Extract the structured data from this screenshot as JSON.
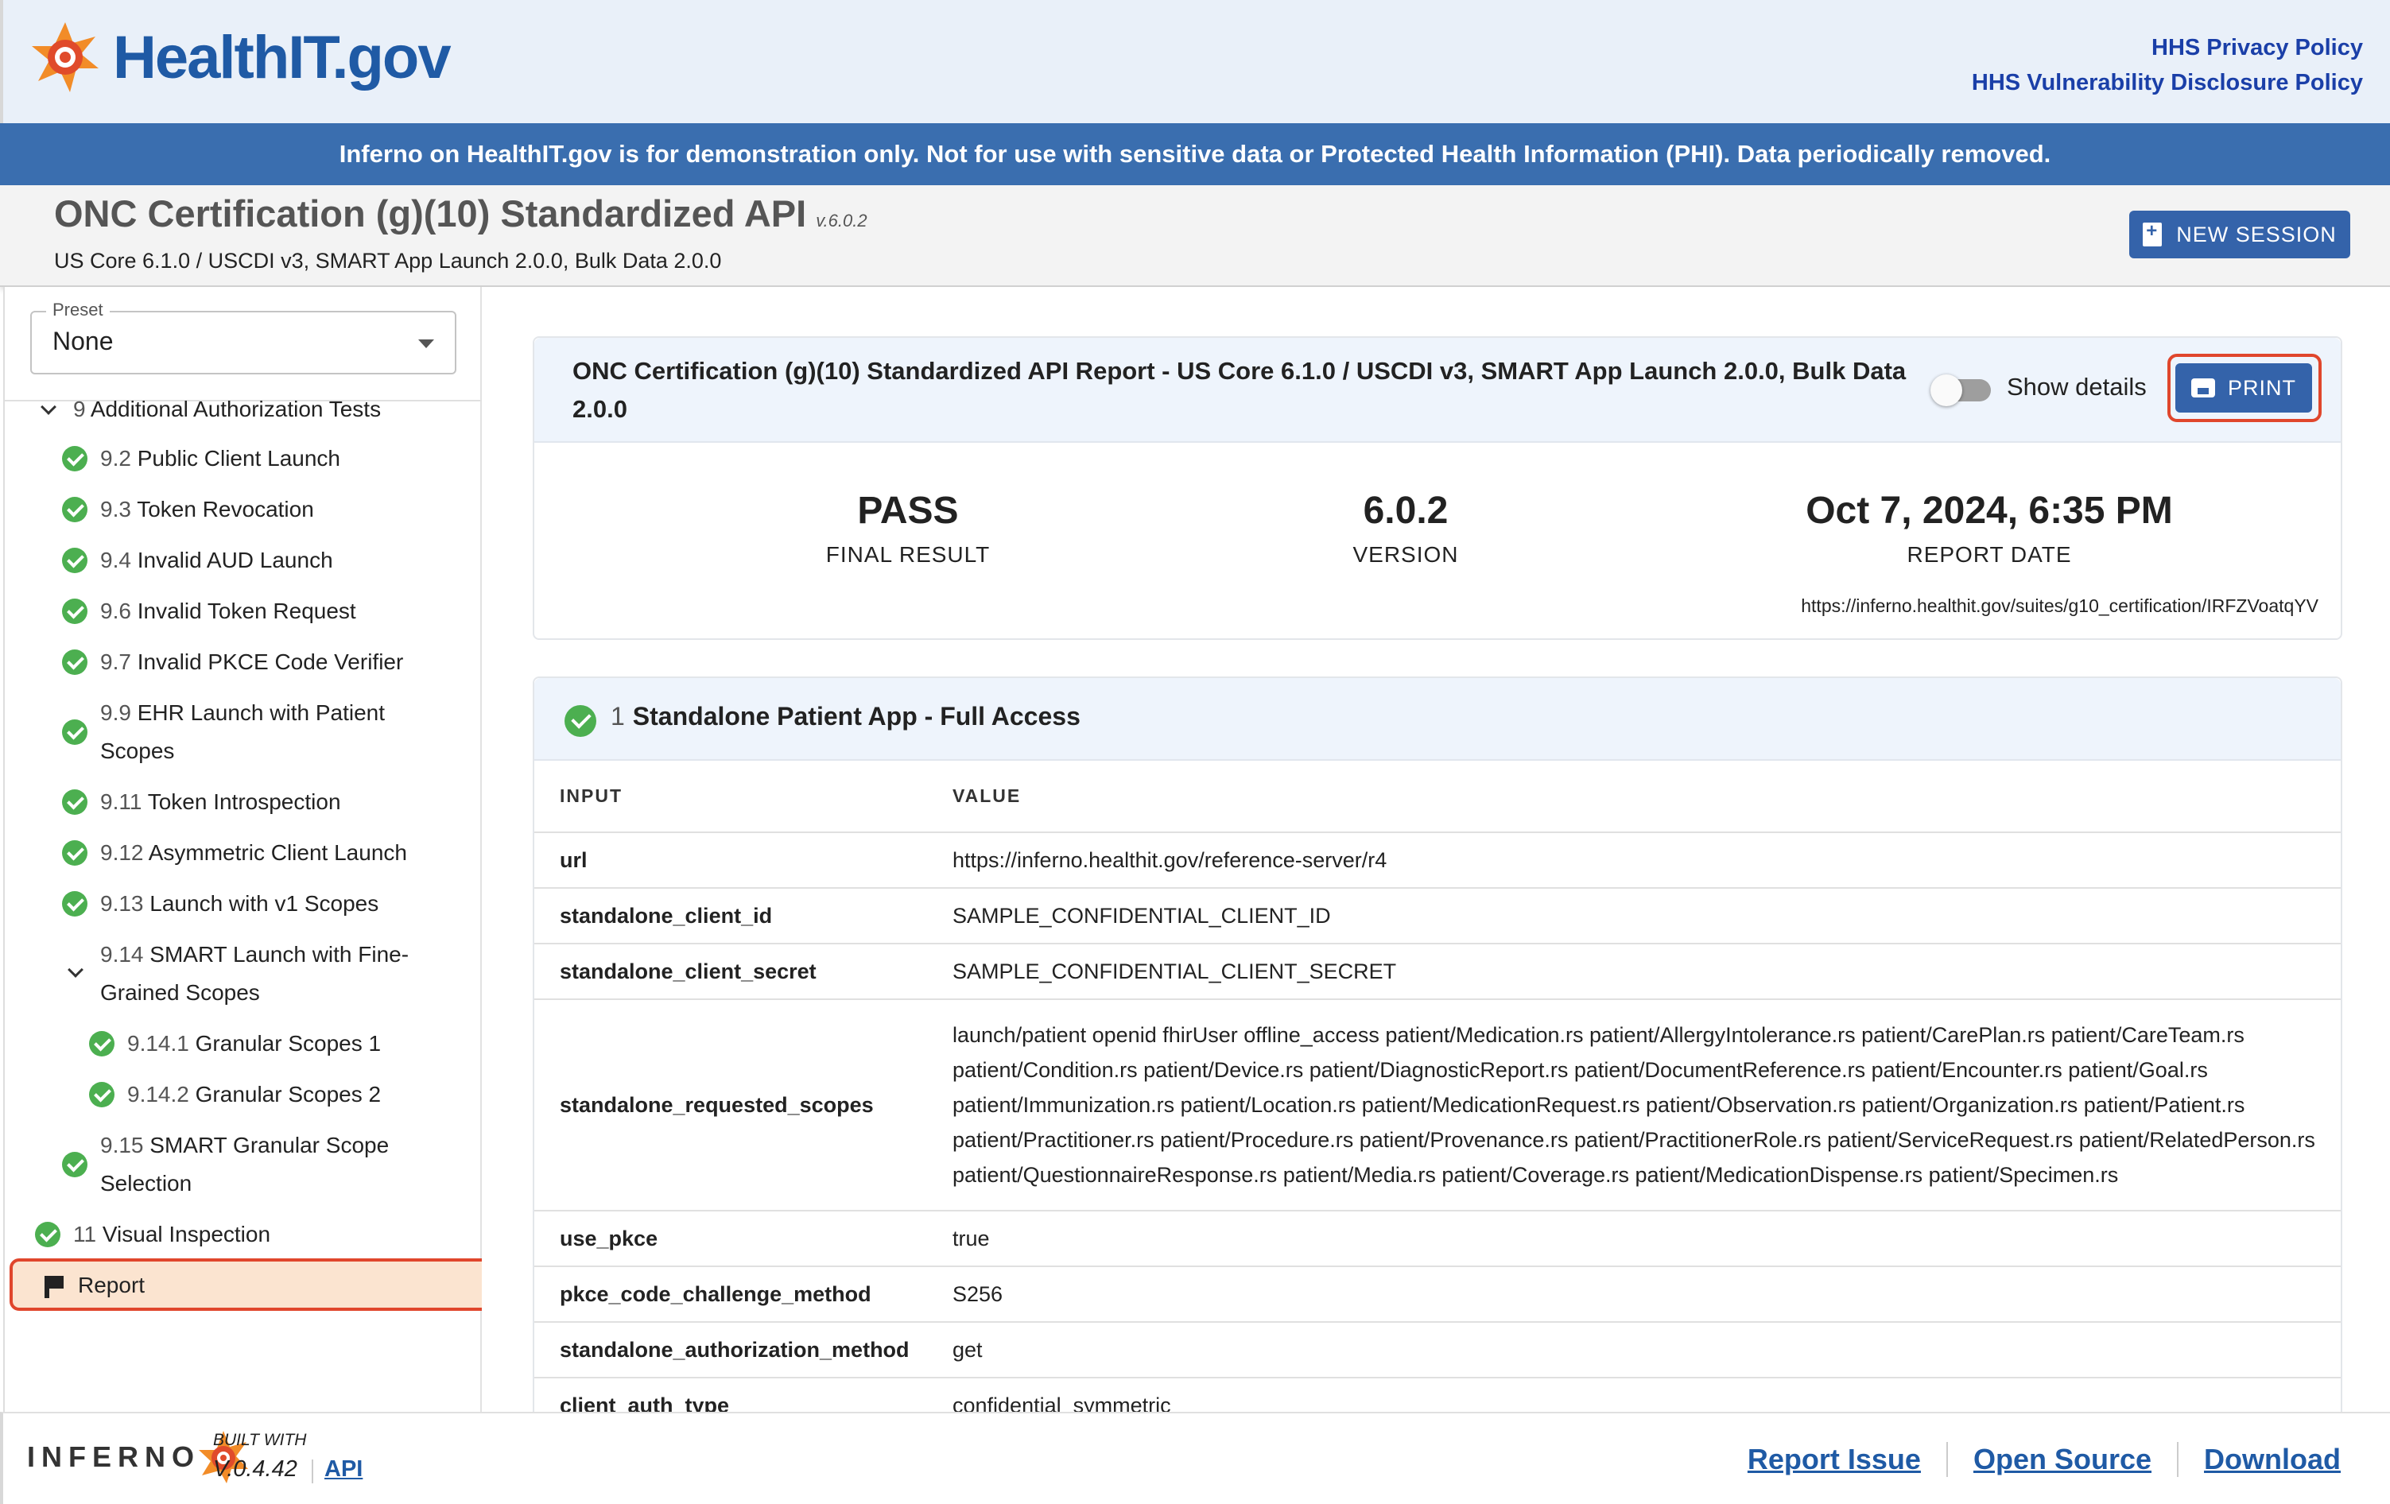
{
  "header": {
    "logo_text": "HealthIT.gov",
    "links": [
      "HHS Privacy Policy",
      "HHS Vulnerability Disclosure Policy"
    ]
  },
  "banner": "Inferno on HealthIT.gov is for demonstration only. Not for use with sensitive data or Protected Health Information (PHI). Data periodically removed.",
  "suite": {
    "title": "ONC Certification (g)(10) Standardized API",
    "version": "v.6.0.2",
    "subtitle": "US Core 6.1.0 / USCDI v3, SMART App Launch 2.0.0, Bulk Data 2.0.0",
    "new_session": "NEW SESSION"
  },
  "sidebar": {
    "preset_label": "Preset",
    "preset_value": "None",
    "items": [
      {
        "num": "9",
        "label": "Additional Authorization Tests"
      },
      {
        "num": "9.2",
        "label": "Public Client Launch"
      },
      {
        "num": "9.3",
        "label": "Token Revocation"
      },
      {
        "num": "9.4",
        "label": "Invalid AUD Launch"
      },
      {
        "num": "9.6",
        "label": "Invalid Token Request"
      },
      {
        "num": "9.7",
        "label": "Invalid PKCE Code Verifier"
      },
      {
        "num": "9.9",
        "label": "EHR Launch with Patient",
        "label2": "Scopes"
      },
      {
        "num": "9.11",
        "label": "Token Introspection"
      },
      {
        "num": "9.12",
        "label": "Asymmetric Client Launch"
      },
      {
        "num": "9.13",
        "label": "Launch with v1 Scopes"
      },
      {
        "num": "9.14",
        "label": "SMART Launch with Fine-",
        "label2": "Grained Scopes"
      },
      {
        "num": "9.14.1",
        "label": "Granular Scopes 1"
      },
      {
        "num": "9.14.2",
        "label": "Granular Scopes 2"
      },
      {
        "num": "9.15",
        "label": "SMART Granular Scope",
        "label2": "Selection"
      },
      {
        "num": "11",
        "label": "Visual Inspection"
      }
    ],
    "report": "Report"
  },
  "report": {
    "title": "ONC Certification (g)(10) Standardized API Report - US Core 6.1.0 / USCDI v3, SMART App Launch 2.0.0, Bulk Data 2.0.0",
    "show_details": "Show details",
    "print": "PRINT",
    "final_result": "PASS",
    "final_result_label": "FINAL RESULT",
    "version": "6.0.2",
    "version_label": "VERSION",
    "report_date": "Oct 7, 2024, 6:35 PM",
    "report_date_label": "REPORT DATE",
    "url": "https://inferno.healthit.gov/suites/g10_certification/IRFZVoatqYV"
  },
  "group": {
    "num": "1",
    "title": "Standalone Patient App - Full Access",
    "col_input": "INPUT",
    "col_value": "VALUE",
    "rows": [
      {
        "key": "url",
        "value": "https://inferno.healthit.gov/reference-server/r4"
      },
      {
        "key": "standalone_client_id",
        "value": "SAMPLE_CONFIDENTIAL_CLIENT_ID"
      },
      {
        "key": "standalone_client_secret",
        "value": "SAMPLE_CONFIDENTIAL_CLIENT_SECRET"
      },
      {
        "key": "standalone_requested_scopes",
        "value": "launch/patient openid fhirUser offline_access patient/Medication.rs patient/AllergyIntolerance.rs patient/CarePlan.rs patient/CareTeam.rs patient/Condition.rs patient/Device.rs patient/DiagnosticReport.rs patient/DocumentReference.rs patient/Encounter.rs patient/Goal.rs patient/Immunization.rs patient/Location.rs patient/MedicationRequest.rs patient/Observation.rs patient/Organization.rs patient/Patient.rs patient/Practitioner.rs patient/Procedure.rs patient/Provenance.rs patient/PractitionerRole.rs patient/ServiceRequest.rs patient/RelatedPerson.rs patient/QuestionnaireResponse.rs patient/Media.rs patient/Coverage.rs patient/MedicationDispense.rs patient/Specimen.rs"
      },
      {
        "key": "use_pkce",
        "value": "true"
      },
      {
        "key": "pkce_code_challenge_method",
        "value": "S256"
      },
      {
        "key": "standalone_authorization_method",
        "value": "get"
      },
      {
        "key": "client_auth_type",
        "value": "confidential_symmetric"
      }
    ]
  },
  "footer": {
    "logo_text": "INFERNO",
    "built_with": "BUILT WITH",
    "version": "V.0.4.42",
    "api": "API",
    "links": [
      "Report Issue",
      "Open Source",
      "Download"
    ]
  }
}
